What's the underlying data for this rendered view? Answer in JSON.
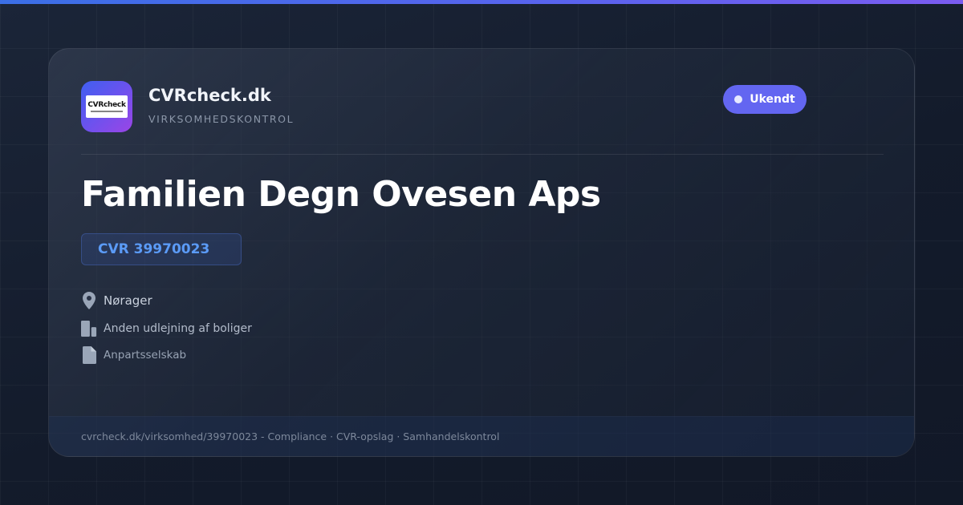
{
  "brand": {
    "logo_text": "CVRcheck",
    "name": "CVRcheck.dk",
    "tagline": "VIRKSOMHEDSKONTROL"
  },
  "status": {
    "label": "Ukendt",
    "color": "#6366f1"
  },
  "company": {
    "name": "Familien Degn Ovesen Aps",
    "cvr": "CVR 39970023",
    "location": "Nørager",
    "industry": "Anden udlejning af boliger",
    "company_type": "Anpartsselskab"
  },
  "footer": {
    "text": "cvrcheck.dk/virksomhed/39970023 - Compliance · CVR-opslag · Samhandelskontrol"
  },
  "icons": {
    "location": "map-pin-icon",
    "industry": "building-icon",
    "type": "document-icon"
  },
  "colors": {
    "accent": "#6366f1",
    "cvr_text": "#5b9bf7",
    "top_bar_start": "#3b6fe6",
    "top_bar_end": "#7b5cf0"
  }
}
